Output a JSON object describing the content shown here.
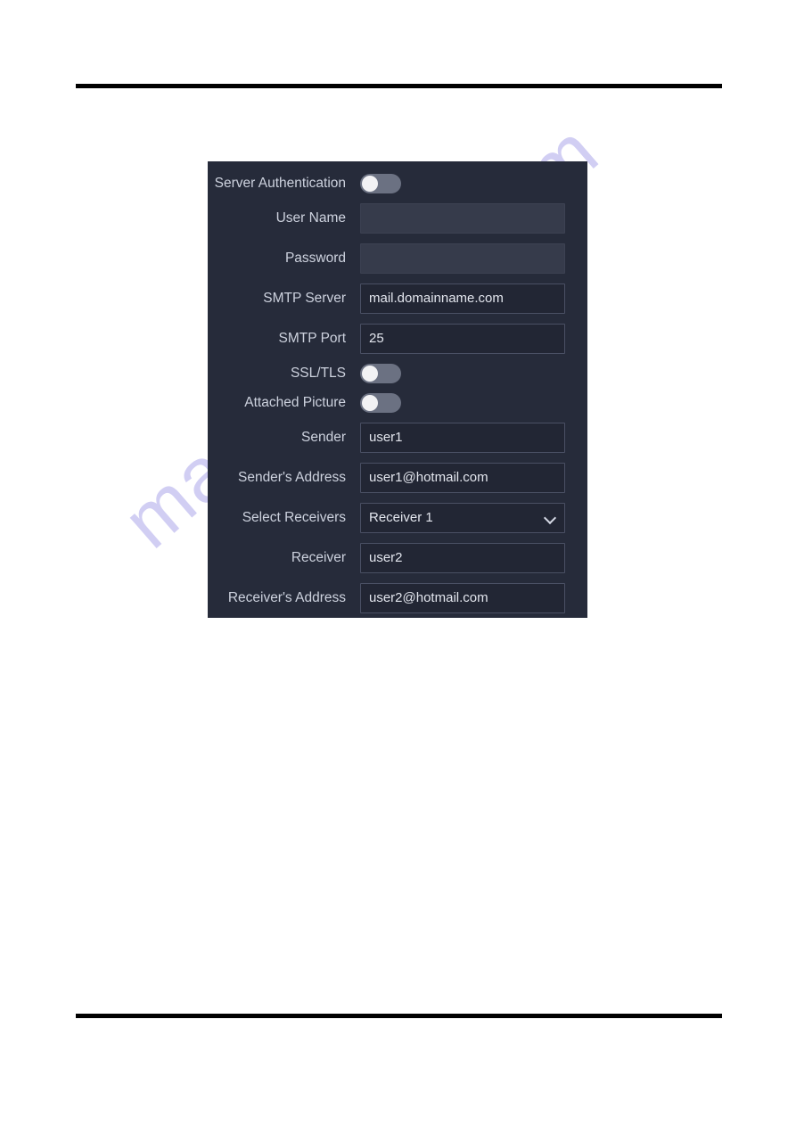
{
  "page": {
    "background_color": "#ffffff",
    "rule_color": "#000000",
    "watermark_text": "manualslive.com",
    "watermark_color": "#c9c6f2"
  },
  "panel": {
    "background_color": "#262b3a",
    "label_color": "#cdd2de",
    "value_color": "#e3e6ee",
    "accent_color": "#6b7182",
    "rows": [
      {
        "label": "Server Authentication",
        "type": "toggle",
        "state": "off",
        "icon": "toggle-switch-icon"
      },
      {
        "label": "User Name",
        "type": "input",
        "value": "",
        "placeholder": ""
      },
      {
        "label": "Password",
        "type": "input",
        "value": "",
        "placeholder": ""
      },
      {
        "label": "SMTP Server",
        "type": "input",
        "value": "mail.domainname.com",
        "placeholder": ""
      },
      {
        "label": "SMTP Port",
        "type": "input",
        "value": "25",
        "placeholder": ""
      },
      {
        "label": "SSL/TLS",
        "type": "toggle",
        "state": "off",
        "icon": "toggle-switch-icon"
      },
      {
        "label": "Attached Picture",
        "type": "toggle",
        "state": "off",
        "icon": "toggle-switch-icon"
      },
      {
        "label": "Sender",
        "type": "input",
        "value": "user1",
        "placeholder": ""
      },
      {
        "label": "Sender's Address",
        "type": "input",
        "value": "user1@hotmail.com",
        "placeholder": ""
      },
      {
        "label": "Select Receivers",
        "type": "select",
        "value": "Receiver 1",
        "icon": "chevron-down-icon",
        "options": [
          "Receiver 1"
        ]
      },
      {
        "label": "Receiver",
        "type": "input",
        "value": "user2",
        "placeholder": ""
      },
      {
        "label": "Receiver's Address",
        "type": "input",
        "value": "user2@hotmail.com",
        "placeholder": ""
      }
    ]
  }
}
